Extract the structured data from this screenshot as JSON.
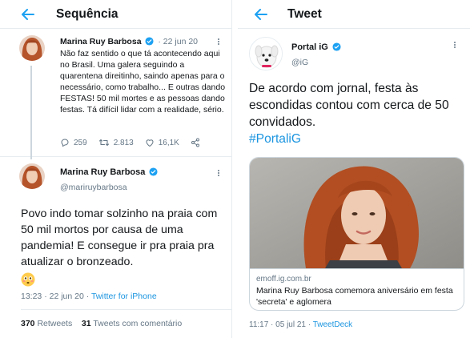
{
  "left_panel": {
    "header_title": "Sequência",
    "tweet1": {
      "name": "Marina Ruy Barbosa",
      "dots": "·",
      "date": "22 jun 20",
      "text": "Não faz sentido o que tá acontecendo aqui no Brasil. Uma galera seguindo a quarentena direitinho, saindo apenas para o necessário, como trabalho... E outras dando FESTAS! 50 mil mortes e as pessoas dando festas. Tá difícil lidar com a realidade, sério.",
      "replies": "259",
      "retweets": "2.813",
      "likes": "16,1K"
    },
    "tweet2": {
      "name": "Marina Ruy Barbosa",
      "handle": "@mariruybarbosa",
      "text": "Povo indo tomar solzinho na praia com 50 mil mortos por causa de uma pandemia! E consegue ir pra praia pra atualizar o bronzeado.",
      "time": "13:23 · 22 jun 20 · ",
      "source": "Twitter for iPhone",
      "retweets_count": "370",
      "retweets_label": "Retweets",
      "comments_count": "31",
      "comments_label": "Tweets com comentário"
    }
  },
  "right_panel": {
    "header_title": "Tweet",
    "tweet": {
      "name": "Portal iG",
      "handle": "@iG",
      "text": "De acordo com jornal, festa às escondidas contou com cerca de 50 convidados.",
      "hashtag": "#PortaliG",
      "card_domain": "emoff.ig.com.br",
      "card_title": "Marina Ruy Barbosa comemora aniversário em festa 'secreta' e aglomera",
      "time": "11:17 · 05 jul 21 · ",
      "source": "TweetDeck"
    }
  },
  "colors": {
    "accent": "#1da1f2",
    "link": "#1b95e0",
    "text": "#14171a",
    "muted": "#657786",
    "border": "#e6ecf0"
  },
  "icons": [
    "back-arrow-icon",
    "verified-icon",
    "caret-down-icon",
    "reply-icon",
    "retweet-icon",
    "like-icon",
    "share-icon",
    "flushed-face-emoji"
  ]
}
